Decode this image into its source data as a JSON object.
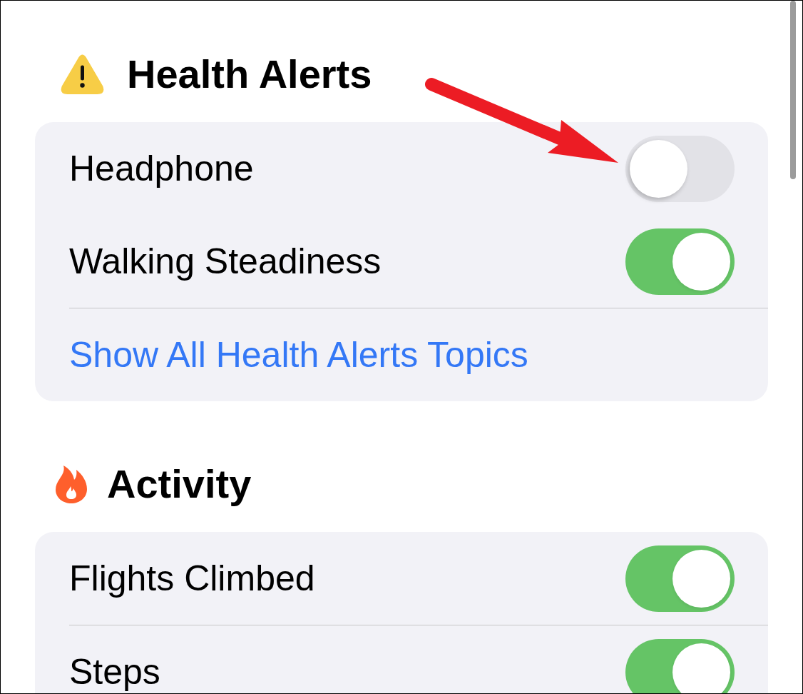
{
  "sections": [
    {
      "kind": "alerts",
      "title": "Health Alerts",
      "rows": [
        {
          "kind": "toggle",
          "label": "Headphone",
          "on": false,
          "divider": false
        },
        {
          "kind": "toggle",
          "label": "Walking Steadiness",
          "on": true,
          "divider": true
        },
        {
          "kind": "link",
          "label": "Show All Health Alerts Topics",
          "divider": false
        }
      ]
    },
    {
      "kind": "activity",
      "title": "Activity",
      "rows": [
        {
          "kind": "toggle",
          "label": "Flights Climbed",
          "on": true,
          "divider": true
        },
        {
          "kind": "toggle",
          "label": "Steps",
          "on": true,
          "divider": false
        }
      ]
    }
  ]
}
